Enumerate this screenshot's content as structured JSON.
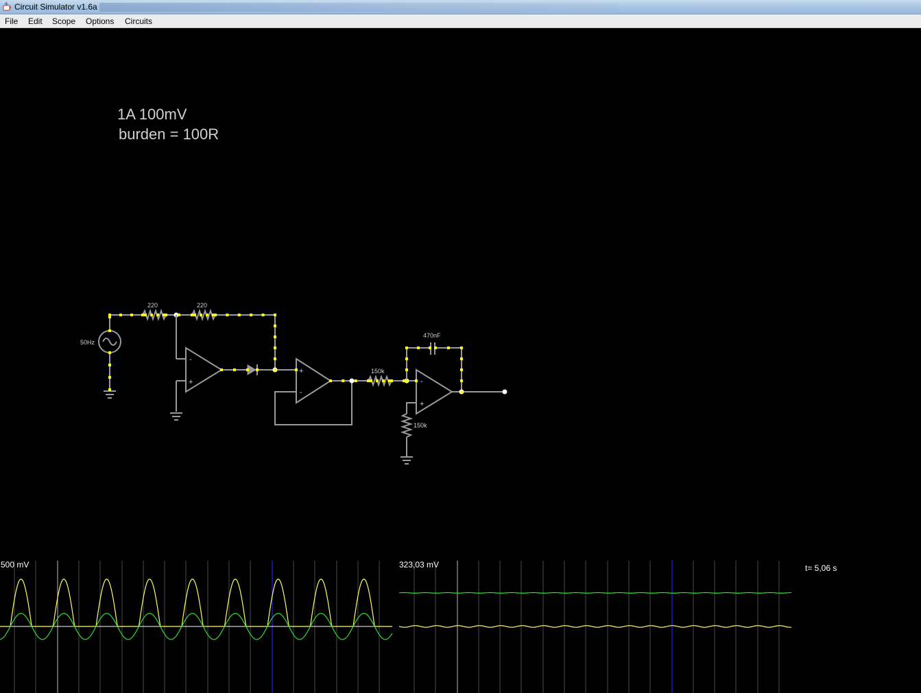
{
  "window": {
    "title": "Circuit Simulator v1.6a",
    "icon": "java-cup-icon"
  },
  "menu": {
    "items": [
      {
        "label": "File"
      },
      {
        "label": "Edit"
      },
      {
        "label": "Scope"
      },
      {
        "label": "Options"
      },
      {
        "label": "Circuits"
      }
    ]
  },
  "circuit": {
    "note_line1": "1A 100mV",
    "note_line2": "burden = 100R",
    "source_label": "50Hz",
    "resistor1_label": "220",
    "resistor2_label": "220",
    "resistor3_label": "150k",
    "resistor4_label": "150k",
    "capacitor_label": "470nF",
    "opamp_minus": "-",
    "opamp_plus": "+"
  },
  "scopes": {
    "left_label": "500 mV",
    "right_label": "323,03 mV",
    "time_label": "t= 5,06 s",
    "trace_colors": {
      "yellow": "#ffff66",
      "green": "#33dd33"
    }
  },
  "colors": {
    "wire_inactive": "#9a9a9a",
    "wire_active": "#9a9a9a",
    "current_dots": "#ffff00",
    "text": "#d0d0d0"
  }
}
